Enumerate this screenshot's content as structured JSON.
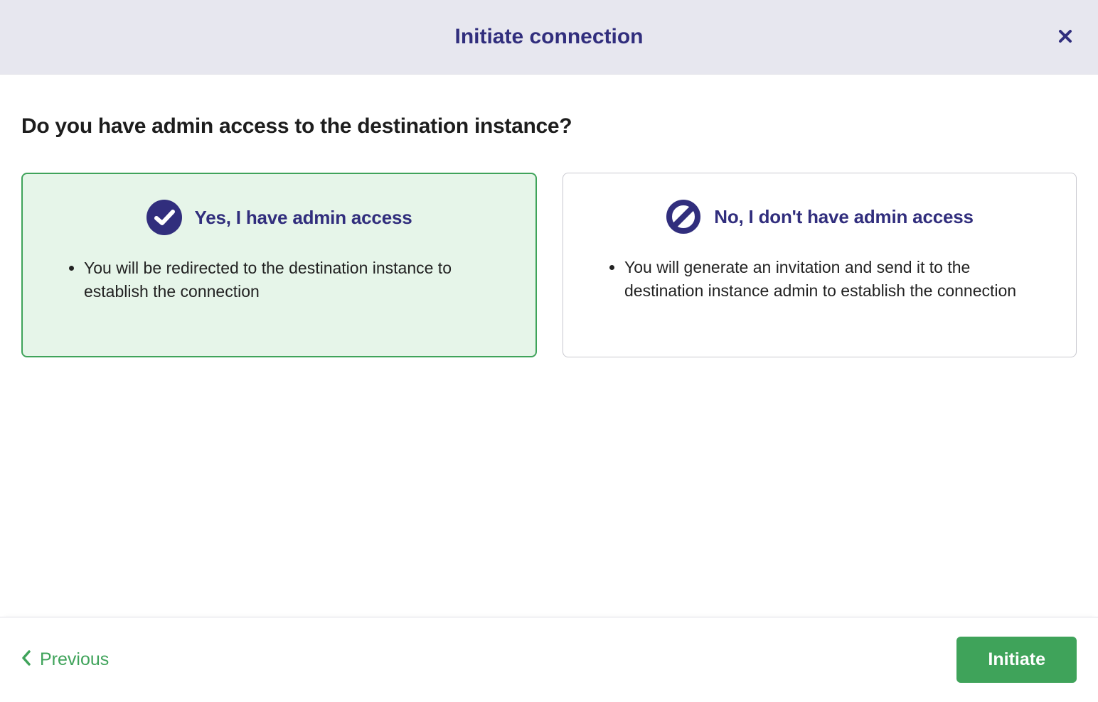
{
  "header": {
    "title": "Initiate connection"
  },
  "question": "Do you have admin access to the destination instance?",
  "options": {
    "yes": {
      "title": "Yes, I have admin access",
      "bullet": "You will be redirected to the destination instance to establish the connection",
      "selected": true
    },
    "no": {
      "title": "No, I don't have admin access",
      "bullet": "You will generate an invitation and send it to the destination instance admin to establish the connection",
      "selected": false
    }
  },
  "footer": {
    "previous_label": "Previous",
    "initiate_label": "Initiate"
  },
  "colors": {
    "brand_purple": "#312e7d",
    "accent_green": "#3fa35a",
    "selected_bg": "#e6f5e9"
  }
}
